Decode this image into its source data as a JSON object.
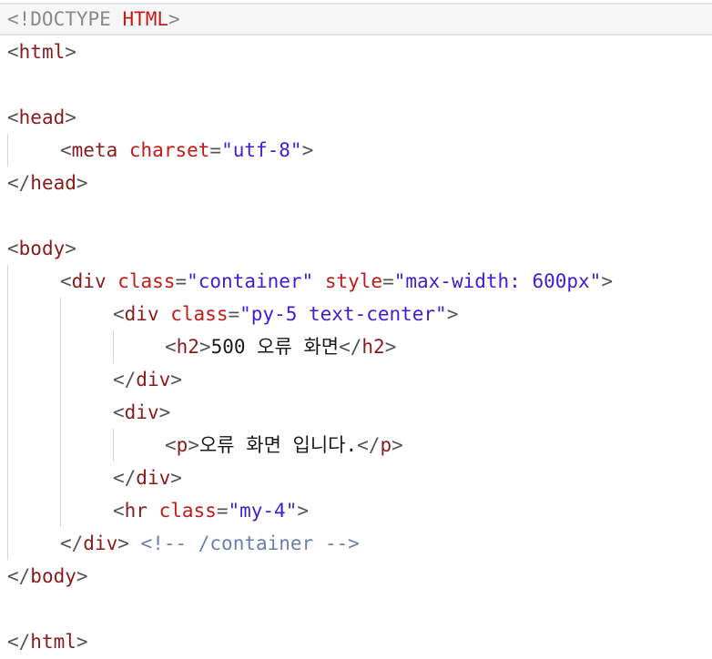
{
  "code": {
    "doctype_open": "<!DOCTYPE ",
    "doctype_kw": "HTML",
    "doctype_close": ">",
    "html_tag": "html",
    "head_tag": "head",
    "meta_tag": "meta",
    "charset_attr": "charset",
    "charset_value": "\"utf-8\"",
    "body_tag": "body",
    "div_tag": "div",
    "class_attr": "class",
    "style_attr": "style",
    "container_class": "\"container\"",
    "container_style": "\"max-width: 600px\"",
    "py5_class": "\"py-5 text-center\"",
    "h2_tag": "h2",
    "h2_text": "500 오류 화면",
    "p_tag": "p",
    "p_text": "오류 화면 입니다.",
    "hr_tag": "hr",
    "hr_class": "\"my-4\"",
    "container_comment": "<!-- /container -->"
  },
  "colors": {
    "tag": "#8b1a1a",
    "attr": "#c41a16",
    "string": "#3a1fd8",
    "comment": "#6a7fb0"
  }
}
